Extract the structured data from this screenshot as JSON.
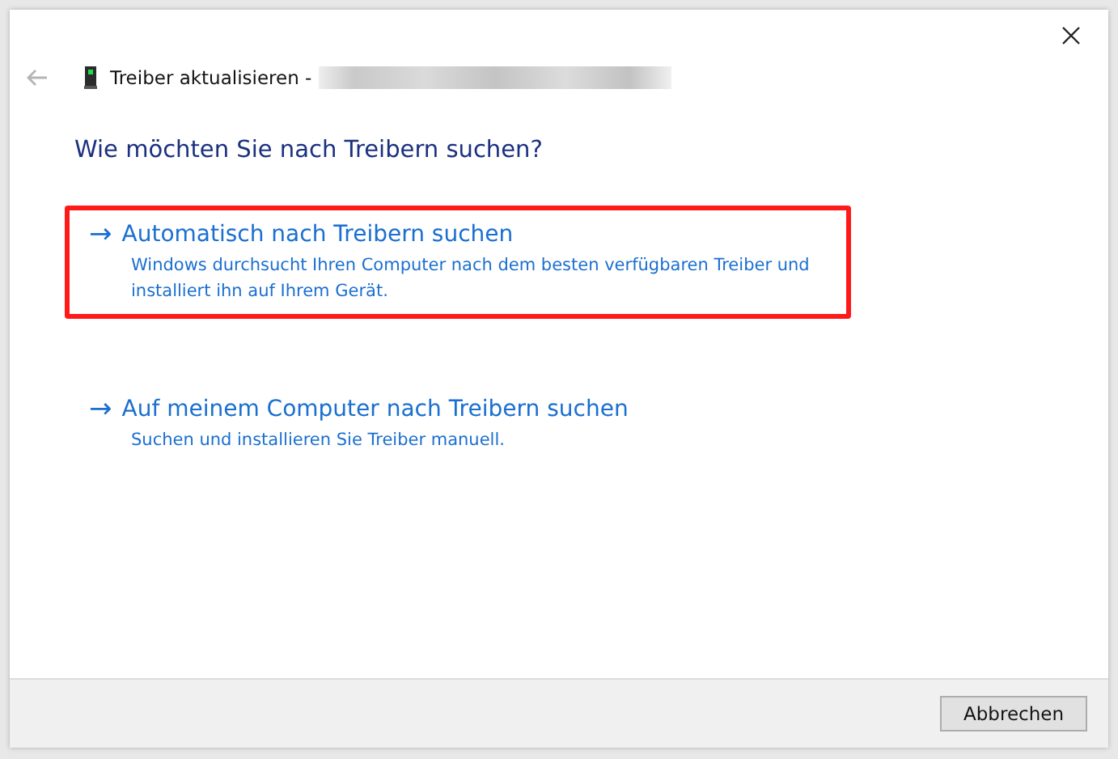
{
  "window": {
    "title": "Treiber aktualisieren -",
    "title_redacted": true
  },
  "heading": "Wie möchten Sie nach Treibern suchen?",
  "options": [
    {
      "arrow": "→",
      "title": "Automatisch nach Treibern suchen",
      "description": "Windows durchsucht Ihren Computer nach dem besten verfügbaren Treiber und installiert ihn auf Ihrem Gerät.",
      "highlighted": true
    },
    {
      "arrow": "→",
      "title": "Auf meinem Computer nach Treibern suchen",
      "description": "Suchen und installieren Sie Treiber manuell.",
      "highlighted": false
    }
  ],
  "buttons": [
    {
      "label": "Abbrechen"
    }
  ]
}
